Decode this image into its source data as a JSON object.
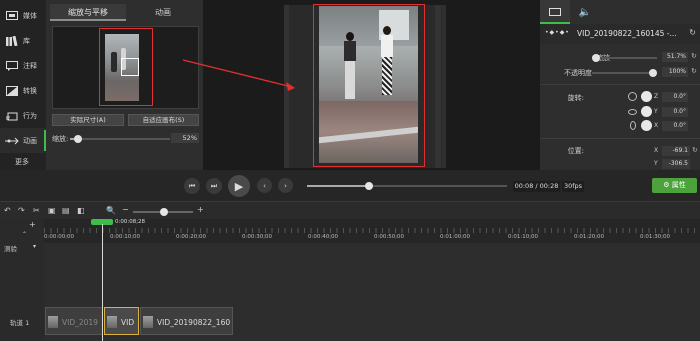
{
  "sidebar": {
    "items": [
      {
        "label": "媒体",
        "icon": "media-icon"
      },
      {
        "label": "库",
        "icon": "library-icon"
      },
      {
        "label": "注释",
        "icon": "annotation-icon"
      },
      {
        "label": "转换",
        "icon": "transition-icon"
      },
      {
        "label": "行为",
        "icon": "behavior-icon"
      },
      {
        "label": "动画",
        "icon": "animation-icon"
      }
    ],
    "more_label": "更多",
    "active_index": 5
  },
  "panel": {
    "tabs": [
      "缩放与平移",
      "动画"
    ],
    "active_tab": 0,
    "actual_size_label": "实际尺寸(A)",
    "fit_label": "自适应画布(S)",
    "zoom_label": "缩放:",
    "zoom_value": "52%",
    "zoom_fraction": 0.52
  },
  "properties": {
    "title": "VID_20190822_160145 -...",
    "keyframe_label": "•◆•◆•",
    "scale_label": "缩放",
    "scale_value": "51.7%",
    "scale_fraction": 0.52,
    "opacity_label": "不透明度",
    "opacity_value": "100%",
    "opacity_fraction": 1.0,
    "rotation_label": "旋转:",
    "rotation": [
      {
        "axis": "Z",
        "value": "0.0°"
      },
      {
        "axis": "Y",
        "value": "0.0°"
      },
      {
        "axis": "X",
        "value": "0.0°"
      }
    ],
    "position_label": "位置:",
    "position": [
      {
        "axis": "X",
        "value": "-69.1"
      },
      {
        "axis": "Y",
        "value": "-306.5"
      }
    ]
  },
  "transport": {
    "current_time": "00:08",
    "total_time": "00:28",
    "time_display": "00:08 / 00:28",
    "fps": "30fps",
    "progress_fraction": 0.31,
    "properties_label": "属性"
  },
  "timeline": {
    "playhead_time": "0:00:08;28",
    "ticks": [
      "0:00:00;00",
      "0:00:10;00",
      "0:00:20;00",
      "0:00:30;00",
      "0:00:40;00",
      "0:00:50;00",
      "0:01:00;00",
      "0:01:10;00",
      "0:01:20;00",
      "0:01:30;00"
    ],
    "test_label": "测验",
    "track_label": "轨道 1",
    "clips": [
      {
        "name": "VID_2019"
      },
      {
        "name": "VID"
      },
      {
        "name": "VID_20190822_160"
      }
    ],
    "zoom_fraction": 0.5
  }
}
